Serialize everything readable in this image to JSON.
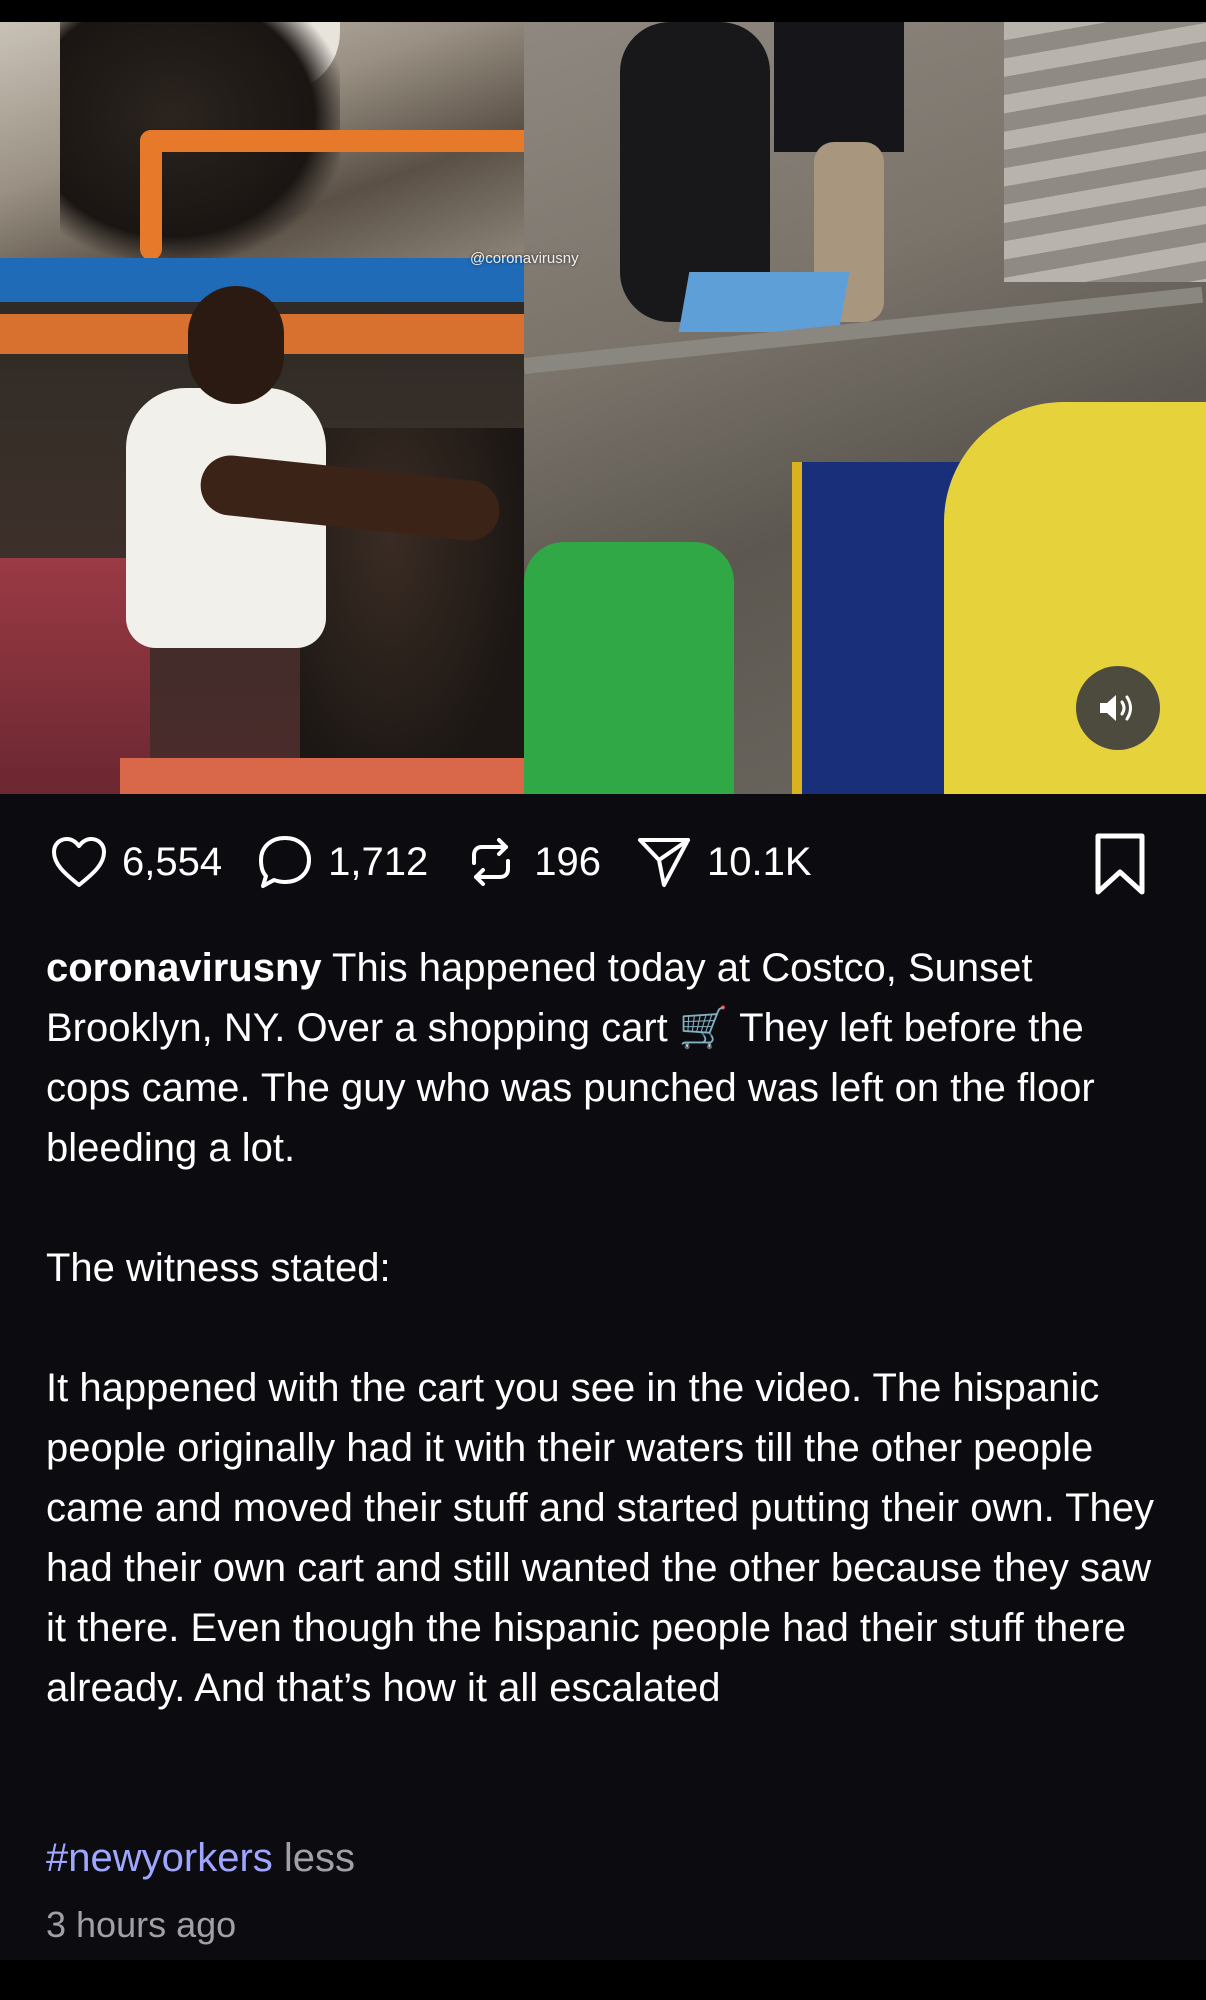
{
  "media": {
    "watermark": "@coronavirusny",
    "sound_icon": "speaker-on-icon"
  },
  "actions": {
    "likes": "6,554",
    "comments": "1,712",
    "reposts": "196",
    "shares": "10.1K",
    "icons": [
      "heart-icon",
      "comment-icon",
      "repost-icon",
      "send-icon",
      "bookmark-icon"
    ]
  },
  "post": {
    "username": "coronavirusny",
    "caption_line1": "This happened today at Costco, Sunset Brooklyn, NY. Over a shopping cart 🛒 They left before the cops came. The guy who was punched was left on the floor bleeding a lot.",
    "caption_line2": "The witness stated:",
    "caption_line3": "It happened with the cart you see in the video. The hispanic people originally had it with their waters till the other people came and moved their stuff and started putting their own. They had their own cart and still wanted the other because they saw it there. Even though the hispanic people had their stuff there already. And that’s how it all escalated",
    "hashtag": "#newyorkers",
    "less_label": "less",
    "timestamp": "3 hours ago"
  },
  "colors": {
    "background": "#0c0c10",
    "hashtag": "#9fa6ff",
    "muted_text": "#a0a0a8"
  }
}
